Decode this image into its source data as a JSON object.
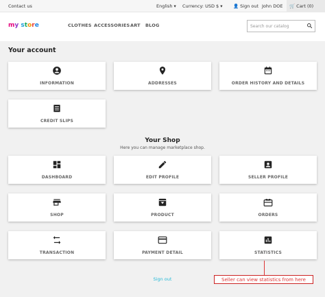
{
  "topbar": {
    "contact": "Contact us",
    "language": "English ▾",
    "currency": "Currency: USD $ ▾",
    "signout": "Sign out",
    "user": "John DOE",
    "cart": "Cart (0)"
  },
  "header": {
    "nav": [
      "CLOTHES",
      "ACCESSORIES",
      "ART",
      "BLOG"
    ],
    "search_placeholder": "Search our catalog"
  },
  "account": {
    "title": "Your account",
    "tiles": [
      "INFORMATION",
      "ADDRESSES",
      "ORDER HISTORY AND DETAILS",
      "CREDIT SLIPS"
    ]
  },
  "shop": {
    "title": "Your Shop",
    "subtitle": "Here you can manage marketplace shop.",
    "tiles": [
      "DASHBOARD",
      "EDIT PROFILE",
      "SELLER PROFILE",
      "SHOP",
      "PRODUCT",
      "ORDERS",
      "TRANSACTION",
      "PAYMENT DETAIL",
      "STATISTICS"
    ]
  },
  "footer": {
    "signout": "Sign out"
  },
  "annotation": "Seller can view statistics from here",
  "colors": {
    "link": "#24b9d7",
    "annotation": "#dd3333"
  }
}
